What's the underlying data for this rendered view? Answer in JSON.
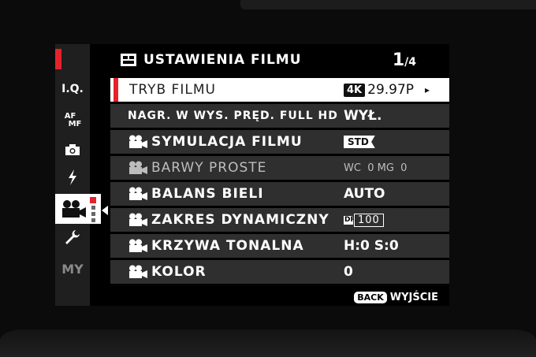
{
  "header": {
    "title": "USTAWIENIA FILMU",
    "page": "1",
    "page_total": "/4"
  },
  "sidebar": {
    "items": [
      {
        "id": "iq",
        "label": "I.Q."
      },
      {
        "id": "af",
        "label_top": "AF",
        "label_bottom": "MF"
      },
      {
        "id": "shooting",
        "icon": "camera-icon"
      },
      {
        "id": "flash",
        "icon": "flash-icon"
      },
      {
        "id": "movie",
        "icon": "movie-camera-icon",
        "selected": true
      },
      {
        "id": "setup",
        "icon": "wrench-icon"
      },
      {
        "id": "my",
        "label": "MY"
      }
    ]
  },
  "menu": {
    "rows": [
      {
        "label": "TRYB FILMU",
        "value_badge": "4K",
        "value": "29.97P",
        "arrow": "▸"
      },
      {
        "label": "NAGR. W WYS. PRĘD. FULL HD",
        "value": "WYŁ."
      },
      {
        "label": "SYMULACJA FILMU",
        "value_badge": "STD"
      },
      {
        "label": "BARWY PROSTE",
        "value": "WC  0 MG  0"
      },
      {
        "label": "BALANS BIELI",
        "value": "AUTO"
      },
      {
        "label": "ZAKRES DYNAMICZNY",
        "dr_letters": "DR",
        "value": "100"
      },
      {
        "label": "KRZYWA TONALNA",
        "value": "H:0 S:0"
      },
      {
        "label": "KOLOR",
        "value": "0"
      }
    ]
  },
  "footer": {
    "back_badge": "BACK",
    "back_label": "WYJŚCIE"
  },
  "colors": {
    "accent": "#e5222b",
    "row_bg": "#2f2f2f",
    "selected_bg": "#ffffff"
  }
}
